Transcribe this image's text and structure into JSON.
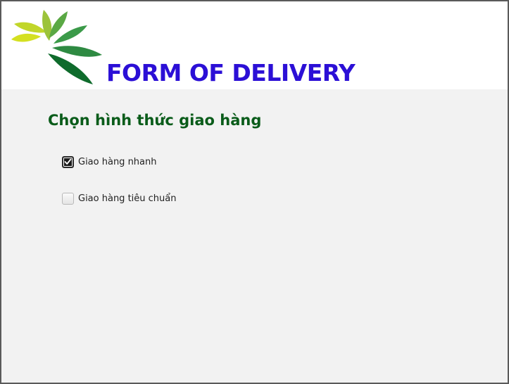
{
  "header": {
    "title": "FORM OF DELIVERY",
    "logo_icon": "leaf-fan-logo-icon",
    "title_color": "#2b0fd6"
  },
  "main": {
    "heading": "Chọn hình thức giao hàng",
    "heading_color": "#0a5c1a",
    "options": [
      {
        "label": "Giao hàng nhanh",
        "checked": true
      },
      {
        "label": "Giao hàng tiêu chuẩn",
        "checked": false
      }
    ]
  },
  "colors": {
    "background": "#f2f2f2",
    "header_background": "#ffffff"
  }
}
